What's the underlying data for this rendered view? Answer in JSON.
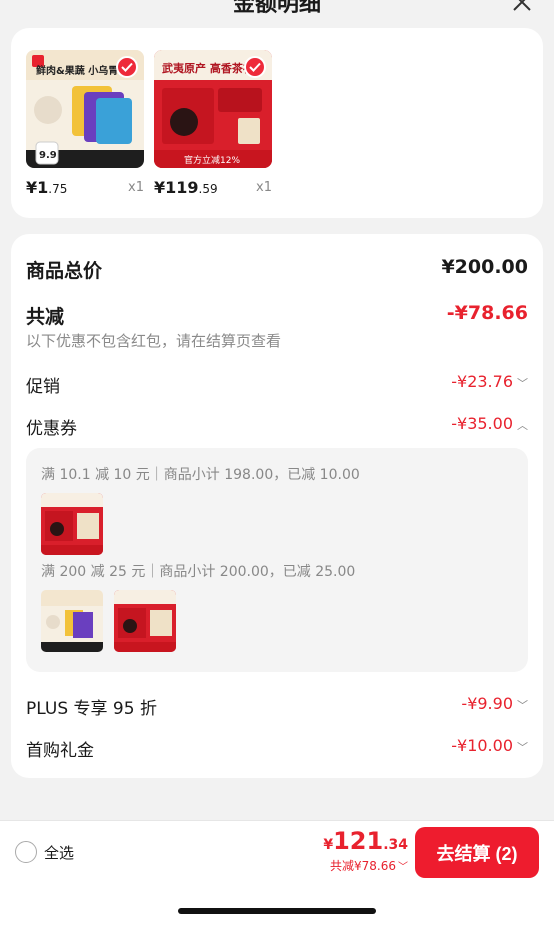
{
  "header": {
    "title": "金额明细"
  },
  "products": [
    {
      "name": "鲜肉&果蔬 小乌胃",
      "price_int": "¥1",
      "price_dec": ".75",
      "qty": "x1",
      "sticker": "9.9"
    },
    {
      "name": "武夷原产 高香茶礼",
      "price_int": "¥119",
      "price_dec": ".59",
      "qty": "x1",
      "sticker": "官方立减12%"
    }
  ],
  "summary": {
    "total_label": "商品总价",
    "total_value": "¥200.00",
    "discount_label": "共减",
    "discount_value": "-¥78.66",
    "hint": "以下优惠不包含红包，请在结算页查看",
    "promo_label": "促销",
    "promo_value": "-¥23.76",
    "coupon_label": "优惠券",
    "coupon_value": "-¥35.00",
    "coupon_detail_1": "满 10.1 减 10 元｜商品小计 198.00，已减 10.00",
    "coupon_detail_2": "满 200 减 25 元｜商品小计 200.00，已减 25.00",
    "plus_label": "PLUS 专享 95 折",
    "plus_value": "-¥9.90",
    "first_label": "首购礼金",
    "first_value": "-¥10.00"
  },
  "footer": {
    "select_all": "全选",
    "currency": "¥",
    "total_int": "121",
    "total_dec": ".34",
    "total_discount": "共减¥78.66",
    "checkout": "去结算 (2)"
  },
  "colors": {
    "accent": "#e8222e",
    "button": "#ee1c2e"
  },
  "icons": [
    "close-icon",
    "check-icon",
    "chevron-down-icon",
    "radio-icon"
  ]
}
